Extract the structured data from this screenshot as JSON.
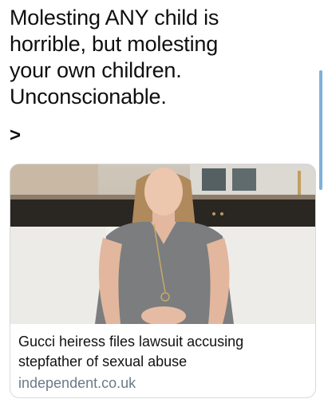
{
  "tweet": {
    "text": "Molesting ANY child is\nhorrible, but molesting\nyour own children.\nUnconscionable.",
    "more_symbol": ">"
  },
  "card": {
    "title": "Gucci heiress files lawsuit accusing stepfather of sexual abuse",
    "domain": "independent.co.uk",
    "image_icon": "video-thumbnail-woman-on-sofa"
  },
  "colors": {
    "text": "#0f0f0f",
    "domain": "#6b7a88",
    "card_border": "#d6d9dc",
    "scroll_indicator": "#7fb0d8"
  }
}
